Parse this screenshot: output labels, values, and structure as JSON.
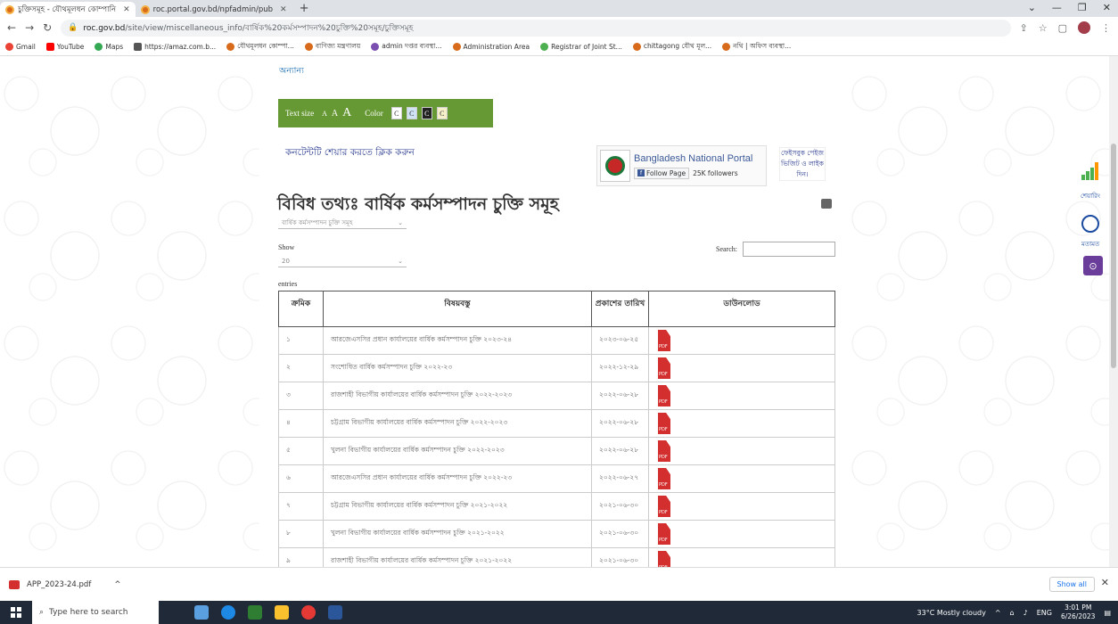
{
  "browser": {
    "tabs": [
      {
        "title": "চুক্তিসমূহ - যৌথমূলধন কোম্পানি",
        "active": true
      },
      {
        "title": "roc.portal.gov.bd/npfadmin/pub",
        "active": false
      }
    ],
    "url_host": "roc.gov.bd",
    "url_path": "/site/view/miscellaneous_info/বার্ষিক%20কর্মসম্পাদন%20চুক্তি%20সমূহ/চুক্তিসমূহ",
    "bookmarks": [
      "Gmail",
      "YouTube",
      "Maps",
      "https://amaz.com.b...",
      "যৌথমূলধন কোম্পা...",
      "বাণিজ্য মন্ত্রণালয়",
      "admin দপ্তর ব্যবস্থা...",
      "Administration Area",
      "Registrar of Joint St...",
      "chittagong যৌথ মূল...",
      "নথি | অফিস ব্যবস্থা..."
    ]
  },
  "page": {
    "misc_link": "অন্যান্য",
    "accessibility": {
      "text_size_label": "Text size",
      "a_small": "A",
      "a_medium": "A",
      "a_large": "A",
      "color_label": "Color",
      "color_c": "C"
    },
    "share_text": "কনটেন্টটি শেয়ার করতে ক্লিক করুন",
    "bnp": {
      "title": "Bangladesh National Portal",
      "follow": "Follow Page",
      "followers": "25K followers"
    },
    "video_link": "ফেইসবুক পেইজ ভিজিট ও লাইক দিন।",
    "title": "বিবিধ তথ্যঃ বার্ষিক কর্মসম্পাদন চুক্তি সমূহ",
    "category_select": "বার্ষিক কর্মসম্পাদন চুক্তি সমূহ",
    "show_label": "Show",
    "show_value": "20",
    "search_label": "Search:",
    "entries_label": "entries",
    "table": {
      "headers": [
        "ক্রমিক",
        "বিষয়বস্তু",
        "প্রকাশের তারিখ",
        "ডাউনলোড"
      ],
      "rows": [
        {
          "no": "১",
          "subject": "আরজেএসসির প্রধান কার্যালয়ের বার্ষিক কর্মসম্পাদন চুক্তি ২০২৩-২৪",
          "date": "২০২৩-০৬-২৫"
        },
        {
          "no": "২",
          "subject": "সংশোধিত বার্ষিক কর্মসম্পাদন চুক্তি ২০২২-২৩",
          "date": "২০২২-১২-২৯"
        },
        {
          "no": "৩",
          "subject": "রাজশাহী বিভাগীয় কার্যালয়ের বার্ষিক কর্মসম্পাদন চুক্তি ২০২২-২০২৩",
          "date": "২০২২-০৬-২৮"
        },
        {
          "no": "৪",
          "subject": "চট্টগ্রাম বিভাগীয় কার্যালয়ের বার্ষিক কর্মসম্পাদন চুক্তি ২০২২-২০২৩",
          "date": "২০২২-০৬-২৮"
        },
        {
          "no": "৫",
          "subject": "খুলনা বিভাগীয় কার্যালয়ের বার্ষিক কর্মসম্পাদন চুক্তি ২০২২-২০২৩",
          "date": "২০২২-০৬-২৮"
        },
        {
          "no": "৬",
          "subject": "আরজেএসসির প্রধান কার্যালয়ের বার্ষিক কর্মসম্পাদন চুক্তি ২০২২-২৩",
          "date": "২০২২-০৬-২৭"
        },
        {
          "no": "৭",
          "subject": "চট্টগ্রাম বিভাগীয় কার্যালয়ের বার্ষিক কর্মসম্পাদন চুক্তি ২০২১-২০২২",
          "date": "২০২১-০৬-৩০"
        },
        {
          "no": "৮",
          "subject": "খুলনা বিভাগীয় কার্যালয়ের বার্ষিক কর্মসম্পাদন চুক্তি ২০২১-২০২২",
          "date": "২০২১-০৬-৩০"
        },
        {
          "no": "৯",
          "subject": "রাজশাহী বিভাগীয় কার্যালয়ের বার্ষিক কর্মসম্পাদন চুক্তি ২০২১-২০২২",
          "date": "২০২১-০৬-৩০"
        }
      ],
      "pdf_label": "PDF"
    },
    "side": {
      "share": "শেয়ারিং",
      "feedback": "মতামত"
    }
  },
  "downloads": {
    "file": "APP_2023-24.pdf",
    "show_all": "Show all"
  },
  "taskbar": {
    "search_placeholder": "Type here to search",
    "weather": "33°C Mostly cloudy",
    "lang": "ENG",
    "time": "3:01 PM",
    "date": "6/26/2023"
  },
  "colors": {
    "accessibility_bar": "#669933",
    "link": "#1a6db0",
    "pdf": "#d32f2f"
  }
}
